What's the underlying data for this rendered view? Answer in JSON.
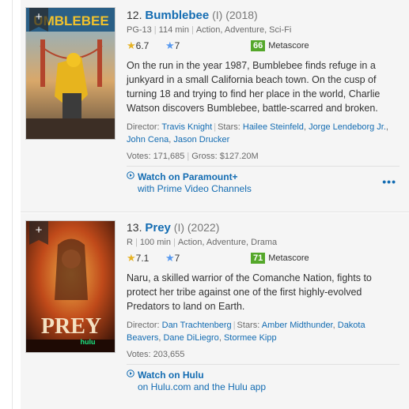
{
  "movies": [
    {
      "index": "12.",
      "title": "Bumblebee",
      "roman": "(I)",
      "year": "(2018)",
      "cert": "PG-13",
      "runtime": "114 min",
      "genres": "Action, Adventure, Sci-Fi",
      "imdb_rating": "6.7",
      "user_rating": "7",
      "metascore": "66",
      "metascore_label": "Metascore",
      "plot": "On the run in the year 1987, Bumblebee finds refuge in a junkyard in a small California beach town. On the cusp of turning 18 and trying to find her place in the world, Charlie Watson discovers Bumblebee, battle-scarred and broken.",
      "director_label": "Director:",
      "director": "Travis Knight",
      "stars_label": "Stars:",
      "stars": [
        "Hailee Steinfeld",
        "Jorge Lendeborg Jr.",
        "John Cena",
        "Jason Drucker"
      ],
      "votes_label": "Votes:",
      "votes": "171,685",
      "gross_label": "Gross:",
      "gross": "$127.20M",
      "watch_title": "Watch on Paramount+",
      "watch_sub": "with Prime Video Channels",
      "more_icon": "•••",
      "poster_text": "UMBLEBEE",
      "colors": {
        "metascore": "#54a72a",
        "link": "#136cb2"
      }
    },
    {
      "index": "13.",
      "title": "Prey",
      "roman": "(I)",
      "year": "(2022)",
      "cert": "R",
      "runtime": "100 min",
      "genres": "Action, Adventure, Drama",
      "imdb_rating": "7.1",
      "user_rating": "7",
      "metascore": "71",
      "metascore_label": "Metascore",
      "plot": "Naru, a skilled warrior of the Comanche Nation, fights to protect her tribe against one of the first highly-evolved Predators to land on Earth.",
      "director_label": "Director:",
      "director": "Dan Trachtenberg",
      "stars_label": "Stars:",
      "stars": [
        "Amber Midthunder",
        "Dakota Beavers",
        "Dane DiLiegro",
        "Stormee Kipp"
      ],
      "votes_label": "Votes:",
      "votes": "203,655",
      "watch_title": "Watch on Hulu",
      "watch_sub": "on Hulu.com and the Hulu app",
      "poster_text": "PREY",
      "poster_brand": "hulu",
      "colors": {
        "metascore": "#54a72a",
        "link": "#136cb2"
      }
    }
  ],
  "ribbon_icon": "+"
}
